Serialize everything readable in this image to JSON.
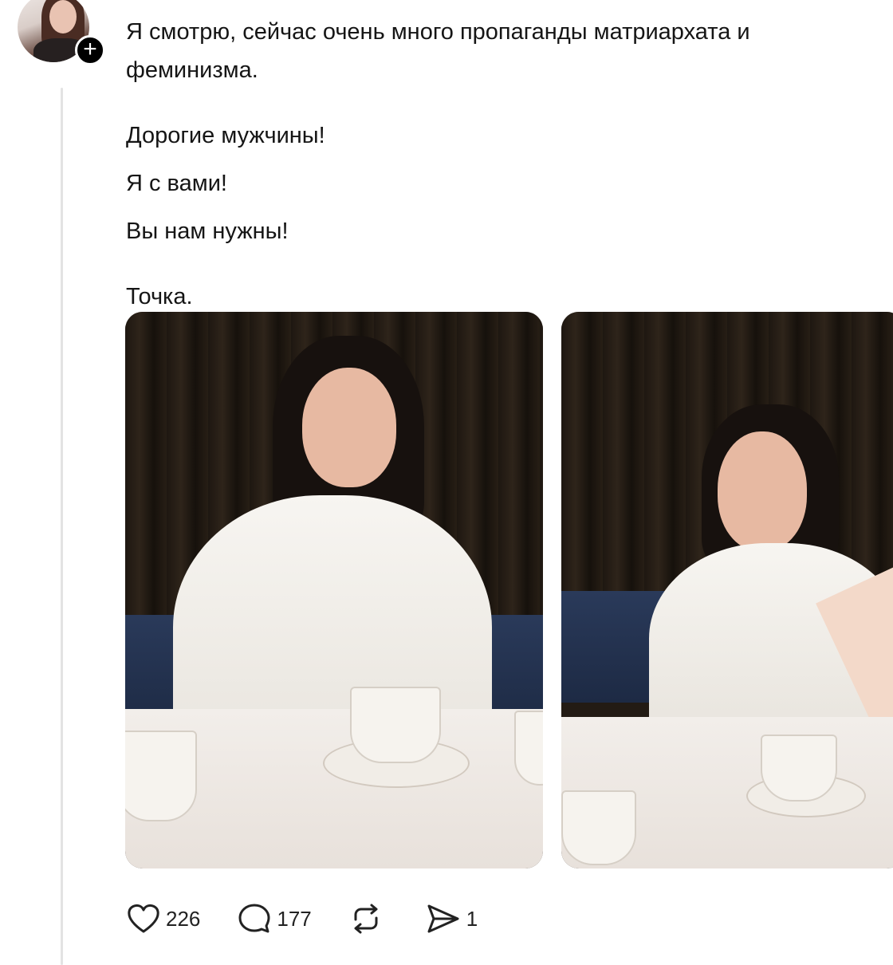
{
  "post": {
    "author": {
      "avatar_icon": "avatar-photo",
      "follow_icon": "plus-icon",
      "follow_symbol": "+"
    },
    "paragraphs": [
      "Я смотрю, сейчас очень много пропаганды матриархата и феминизма.",
      "Дорогие мужчины!",
      "Я с вами!",
      "Вы нам нужны!",
      "Точка."
    ],
    "images": [
      {
        "name": "photo-1",
        "icon": "photo-woman-with-cup"
      },
      {
        "name": "photo-2",
        "icon": "photo-woman-hand-on-cheek"
      }
    ],
    "actions": {
      "likes": "226",
      "replies": "177",
      "reposts": "",
      "shares": "1"
    }
  },
  "colors": {
    "text": "#151515",
    "thread_line": "#e3e3e3",
    "badge": "#000000"
  }
}
